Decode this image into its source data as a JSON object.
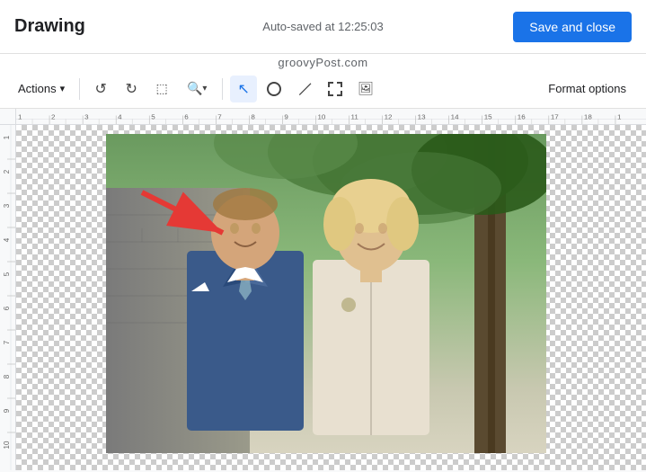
{
  "header": {
    "title": "Drawing",
    "autosave_text": "Auto-saved at 12:25:03",
    "save_close_label": "Save and close"
  },
  "watermark": {
    "text": "groovyPost.com"
  },
  "toolbar": {
    "actions_label": "Actions",
    "actions_arrow": "▾",
    "format_options_label": "Format options",
    "undo_icon": "↺",
    "redo_icon": "↻",
    "select_icon": "⬚",
    "zoom_icon": "🔍",
    "zoom_arrow": "▾",
    "cursor_icon": "↖",
    "shape_icon": "⬜",
    "line_icon": "╱",
    "selection_box_icon": "⬚",
    "image_icon": "🖼"
  },
  "canvas": {
    "ruler_units": [
      "1",
      "2",
      "3",
      "4",
      "5",
      "6",
      "7",
      "8",
      "9",
      "10",
      "11",
      "12",
      "13",
      "14",
      "15",
      "16",
      "17",
      "18",
      "1"
    ],
    "ruler_left_units": [
      "1",
      "2",
      "3",
      "4",
      "5",
      "6",
      "7",
      "8",
      "9",
      "10"
    ]
  }
}
